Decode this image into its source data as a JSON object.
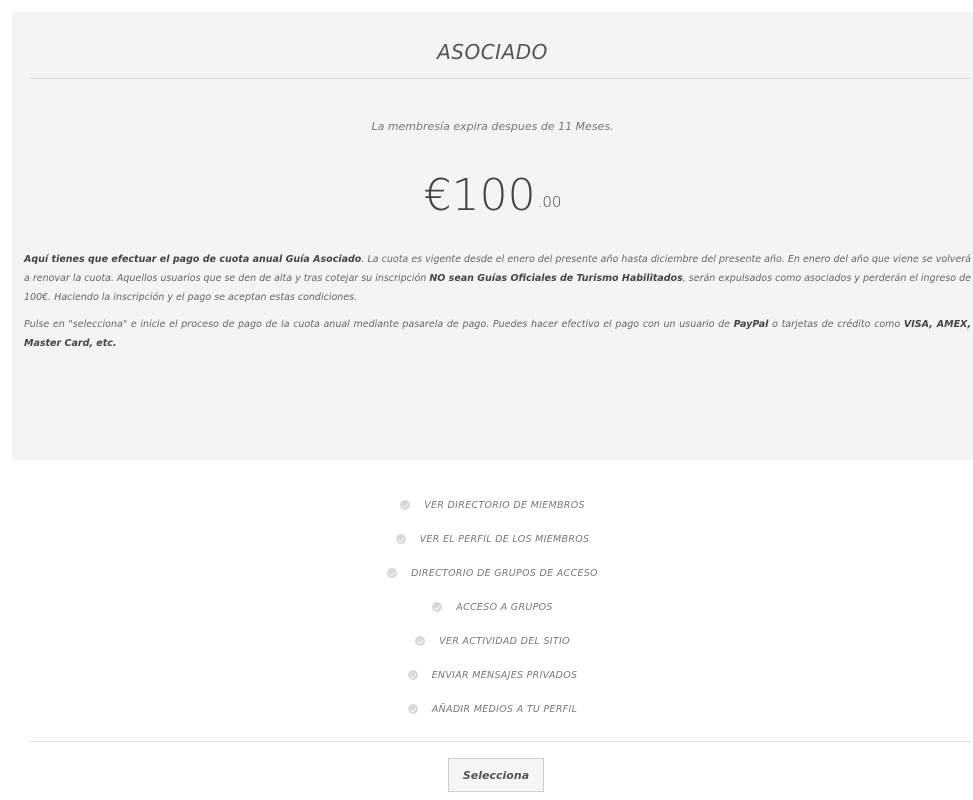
{
  "plan": {
    "title": "ASOCIADO",
    "expiry_text": "La membresía expira despues de 11 Meses.",
    "price_currency": "€",
    "price_amount": "100",
    "price_cents": ".00"
  },
  "description": {
    "p1_bold1": "Aquí tienes que efectuar el pago de cuota anual Guía Asociado",
    "p1_text1": ". La cuota es vigente desde el enero del presente año hasta diciembre del presente año. En enero del año que viene se volverá a renovar la cuota. Aquellos usuarios que se den de alta y tras cotejar su inscripción ",
    "p1_bold2": "NO sean Guías Oficiales de Turismo Habilitados",
    "p1_text2": ", serán expulsados como asociados y perderán el ingreso de 100€. Haciendo la inscripción y el pago se aceptan estas condiciones.",
    "p2_text1": "Pulse en \"selecciona\" e inicie el proceso de pago de la cuota anual mediante pasarela de pago. Puedes hacer efectivo el pago con un usuario de ",
    "p2_bold1": "PayPal",
    "p2_text2": " o tarjetas de crédito como ",
    "p2_bold2": "VISA, AMEX, Master Card, etc."
  },
  "features": [
    "VER DIRECTORIO DE MIEMBROS",
    "VER EL PERFIL DE LOS MIEMBROS",
    "DIRECTORIO DE GRUPOS DE ACCESO",
    "ACCESO A GRUPOS",
    "VER ACTIVIDAD DEL SITIO",
    "ENVIAR MENSAJES PRIVADOS",
    "AÑADIR MEDIOS A TU PERFIL"
  ],
  "feature_icon": "check-circle-icon",
  "select_button_label": "Selecciona",
  "colors": {
    "header_bg": "#f4f4f4",
    "check_bg": "#d8d8d8",
    "text": "#555555"
  }
}
